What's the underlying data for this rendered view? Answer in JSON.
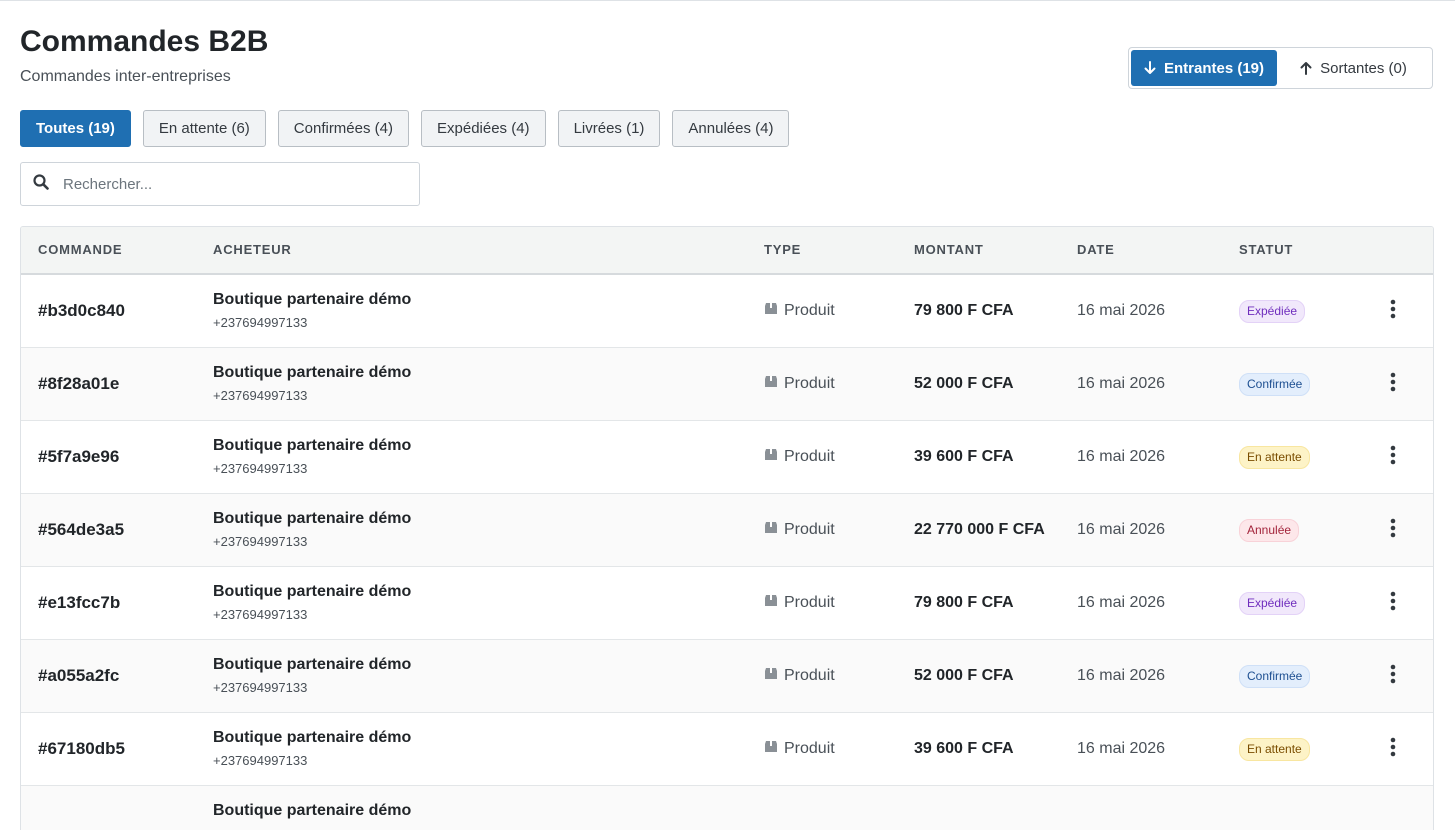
{
  "header": {
    "title": "Commandes B2B",
    "subtitle": "Commandes inter-entreprises"
  },
  "direction": {
    "incoming_label": "Entrantes (19)",
    "outgoing_label": "Sortantes (0)",
    "active": "incoming",
    "incoming_icon": "arrow-down-icon",
    "outgoing_icon": "arrow-up-icon"
  },
  "filters": [
    {
      "label": "Toutes (19)",
      "active": true
    },
    {
      "label": "En attente (6)",
      "active": false
    },
    {
      "label": "Confirmées (4)",
      "active": false
    },
    {
      "label": "Expédiées (4)",
      "active": false
    },
    {
      "label": "Livrées (1)",
      "active": false
    },
    {
      "label": "Annulées (4)",
      "active": false
    }
  ],
  "search": {
    "placeholder": "Rechercher...",
    "value": "",
    "icon": "search-icon"
  },
  "table": {
    "columns": [
      "Commande",
      "Acheteur",
      "Type",
      "Montant",
      "Date",
      "Statut"
    ],
    "rows": [
      {
        "id": "#b3d0c840",
        "buyer": "Boutique partenaire démo",
        "phone": "+237694997133",
        "type": "Produit",
        "amount": "79 800 F CFA",
        "date": "16 mai 2026",
        "status": "Expédiée",
        "status_kind": "shipped"
      },
      {
        "id": "#8f28a01e",
        "buyer": "Boutique partenaire démo",
        "phone": "+237694997133",
        "type": "Produit",
        "amount": "52 000 F CFA",
        "date": "16 mai 2026",
        "status": "Confirmée",
        "status_kind": "confirmed"
      },
      {
        "id": "#5f7a9e96",
        "buyer": "Boutique partenaire démo",
        "phone": "+237694997133",
        "type": "Produit",
        "amount": "39 600 F CFA",
        "date": "16 mai 2026",
        "status": "En attente",
        "status_kind": "pending"
      },
      {
        "id": "#564de3a5",
        "buyer": "Boutique partenaire démo",
        "phone": "+237694997133",
        "type": "Produit",
        "amount": "22 770 000 F CFA",
        "date": "16 mai 2026",
        "status": "Annulée",
        "status_kind": "cancelled"
      },
      {
        "id": "#e13fcc7b",
        "buyer": "Boutique partenaire démo",
        "phone": "+237694997133",
        "type": "Produit",
        "amount": "79 800 F CFA",
        "date": "16 mai 2026",
        "status": "Expédiée",
        "status_kind": "shipped"
      },
      {
        "id": "#a055a2fc",
        "buyer": "Boutique partenaire démo",
        "phone": "+237694997133",
        "type": "Produit",
        "amount": "52 000 F CFA",
        "date": "16 mai 2026",
        "status": "Confirmée",
        "status_kind": "confirmed"
      },
      {
        "id": "#67180db5",
        "buyer": "Boutique partenaire démo",
        "phone": "+237694997133",
        "type": "Produit",
        "amount": "39 600 F CFA",
        "date": "16 mai 2026",
        "status": "En attente",
        "status_kind": "pending"
      },
      {
        "id": "",
        "buyer": "Boutique partenaire démo",
        "phone": "",
        "type": "",
        "amount": "",
        "date": "",
        "status": "",
        "status_kind": "cancelled"
      }
    ],
    "type_icon": "box-icon",
    "row_action_icon": "more-vertical-icon"
  },
  "colors": {
    "primary": "#1f6fb2",
    "shipped": "#6f2dbd",
    "confirmed": "#1d4f91",
    "pending": "#7a4d00",
    "cancelled": "#a3243b"
  }
}
